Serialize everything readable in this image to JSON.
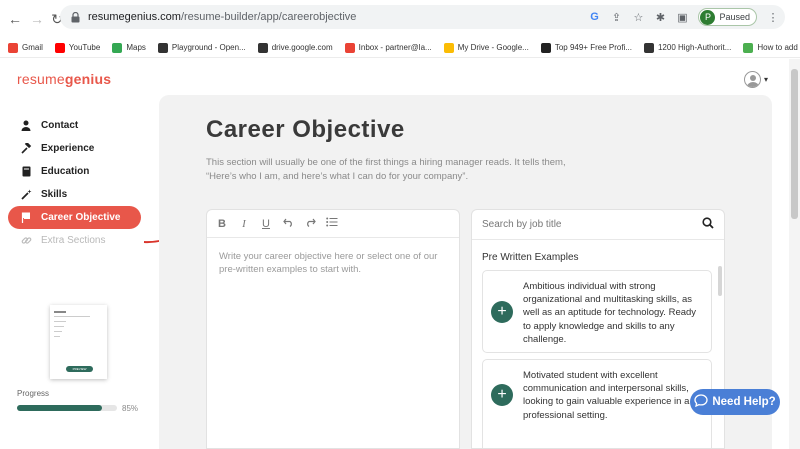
{
  "browser": {
    "url_host": "resumegenius.com",
    "url_path": "/resume-builder/app/careerobjective",
    "profile_initial": "P",
    "profile_status": "Paused",
    "bookmarks": [
      {
        "label": "Gmail",
        "color": "#ea4335"
      },
      {
        "label": "YouTube",
        "color": "#ff0000"
      },
      {
        "label": "Maps",
        "color": "#34a853"
      },
      {
        "label": "Playground - Open...",
        "color": "#333333"
      },
      {
        "label": "drive.google.com",
        "color": "#333333"
      },
      {
        "label": "Inbox - partner@la...",
        "color": "#ea4335"
      },
      {
        "label": "My Drive - Google...",
        "color": "#fbbc04"
      },
      {
        "label": "Top 949+ Free Profi...",
        "color": "#222222"
      },
      {
        "label": "1200 High-Authorit...",
        "color": "#333333"
      },
      {
        "label": "How to add your re...",
        "color": "#4caf50"
      }
    ]
  },
  "app": {
    "logo_light": "resume",
    "logo_bold": "genius",
    "brand_color": "#e8574a",
    "accent_color": "#2e6b5c"
  },
  "sidebar": {
    "items": [
      {
        "label": "Contact",
        "icon": "person-icon"
      },
      {
        "label": "Experience",
        "icon": "hammer-icon"
      },
      {
        "label": "Education",
        "icon": "book-icon"
      },
      {
        "label": "Skills",
        "icon": "magic-wand-icon"
      },
      {
        "label": "Career Objective",
        "icon": "flag-icon"
      },
      {
        "label": "Extra Sections",
        "icon": "link-icon"
      }
    ],
    "preview_button": "PREVIEW",
    "progress_label": "Progress",
    "progress_value": 85,
    "progress_text": "85%"
  },
  "main": {
    "title": "Career Objective",
    "description": "This section will usually be one of the first things a hiring manager reads. It tells them, “Here’s who I am, and here’s what I can do for your company”.",
    "editor_placeholder": "Write your career objective here or select one of our pre-written examples to start with.",
    "toolbar": [
      "B",
      "I",
      "U",
      "undo",
      "redo",
      "list"
    ],
    "search_placeholder": "Search by job title",
    "examples_heading": "Pre Written Examples",
    "examples": [
      "Ambitious individual with strong organizational and multitasking skills, as well as an aptitude for technology. Ready to apply knowledge and skills to any challenge.",
      "Motivated student with excellent communication and interpersonal skills, looking to gain valuable experience in a professional setting."
    ]
  },
  "help": {
    "label": "Need Help?"
  }
}
